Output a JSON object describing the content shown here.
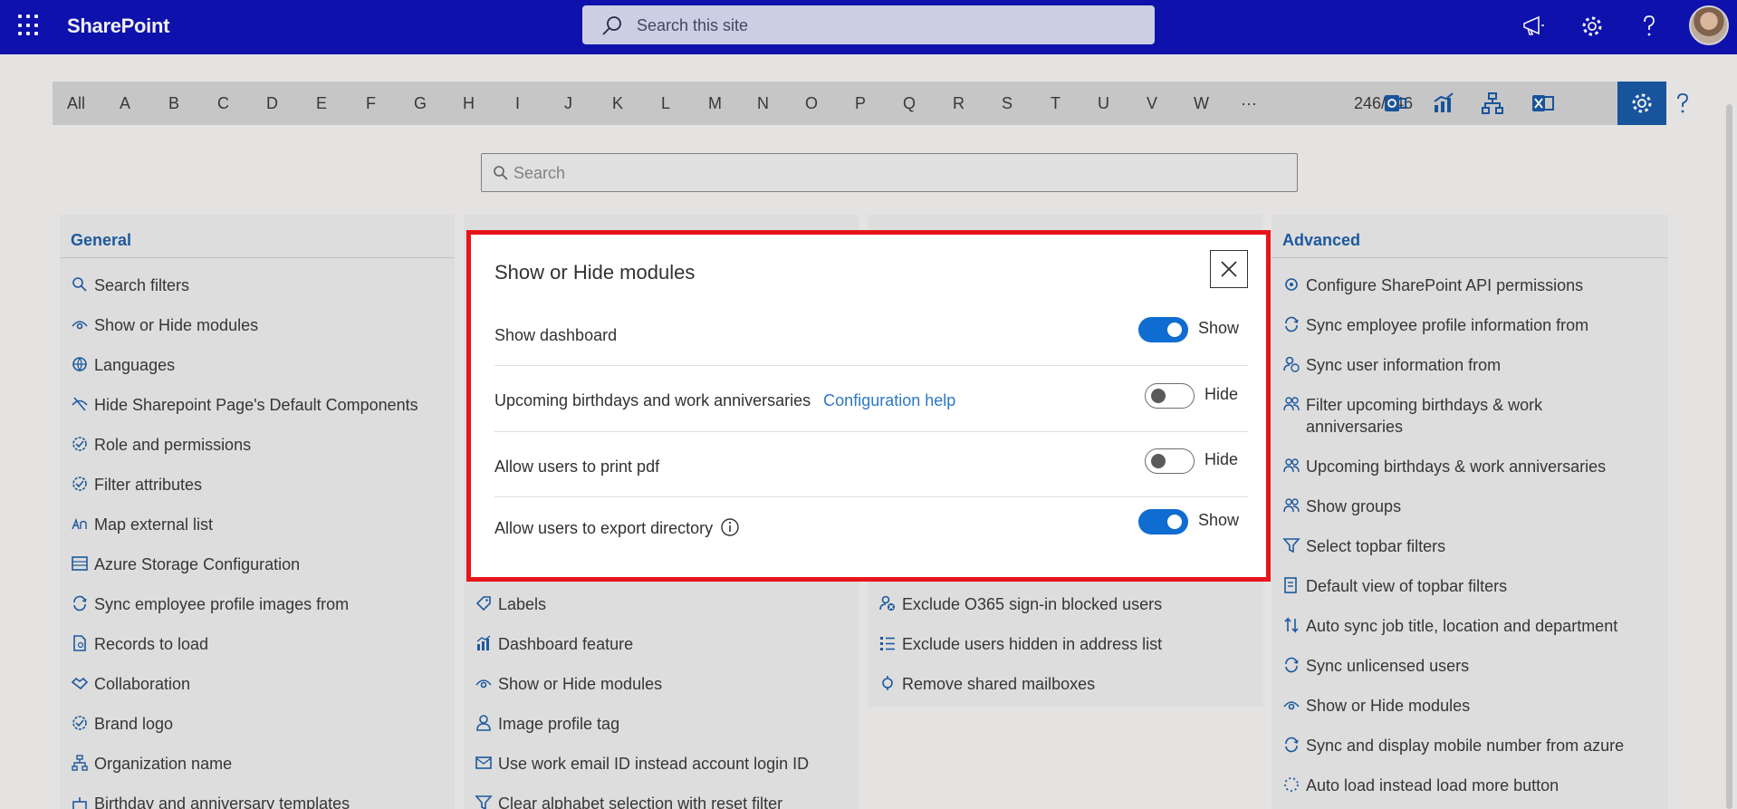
{
  "suitebar": {
    "brand": "SharePoint",
    "search_placeholder": "Search this site",
    "colors": {
      "background": "#0f13b6"
    }
  },
  "alphabar": {
    "letters": [
      "All",
      "A",
      "B",
      "C",
      "D",
      "E",
      "F",
      "G",
      "H",
      "I",
      "J",
      "K",
      "L",
      "M",
      "N",
      "O",
      "P",
      "Q",
      "R",
      "S",
      "T",
      "U",
      "V",
      "W",
      "···"
    ],
    "count": "246/246",
    "icons": [
      "outlook-icon",
      "chart-icon",
      "org-chart-icon",
      "excel-icon",
      "settings-icon",
      "help-icon"
    ]
  },
  "filter_search": {
    "placeholder": "Search"
  },
  "columns": {
    "general": {
      "title": "General",
      "items": [
        "Search filters",
        "Show or Hide modules",
        "Languages",
        "Hide Sharepoint Page's Default Components",
        "Role and permissions",
        "Filter attributes",
        "Map external list",
        "Azure Storage Configuration",
        "Sync employee profile images from",
        "Records to load",
        "Collaboration",
        "Brand logo",
        "Organization name",
        "Birthday and anniversary templates"
      ]
    },
    "second": {
      "items": [
        "Labels",
        "Dashboard feature",
        "Show or Hide modules",
        "Image profile tag",
        "Use work email ID instead account login ID",
        "Clear alphabet selection with reset filter"
      ]
    },
    "third": {
      "items": [
        "Exclude O365 sign-in blocked users",
        "Exclude users hidden in address list",
        "Remove shared mailboxes"
      ]
    },
    "advanced": {
      "title": "Advanced",
      "items": [
        "Configure SharePoint API permissions",
        "Sync employee profile information from",
        "Sync user information from",
        "Filter upcoming birthdays & work anniversaries",
        "Upcoming birthdays & work anniversaries",
        "Show groups",
        "Select topbar filters",
        "Default view of topbar filters",
        "Auto sync job title, location and department",
        "Sync unlicensed users",
        "Show or Hide modules",
        "Sync and display mobile number from azure",
        "Auto load instead load more button"
      ]
    }
  },
  "modal": {
    "title": "Show or Hide modules",
    "rows": [
      {
        "label": "Show dashboard",
        "state": "Show"
      },
      {
        "label": "Upcoming birthdays and work anniversaries",
        "link": "Configuration help",
        "state": "Hide"
      },
      {
        "label": "Allow users to print pdf",
        "state": "Hide"
      },
      {
        "label": "Allow users to export directory",
        "state": "Show"
      }
    ]
  }
}
